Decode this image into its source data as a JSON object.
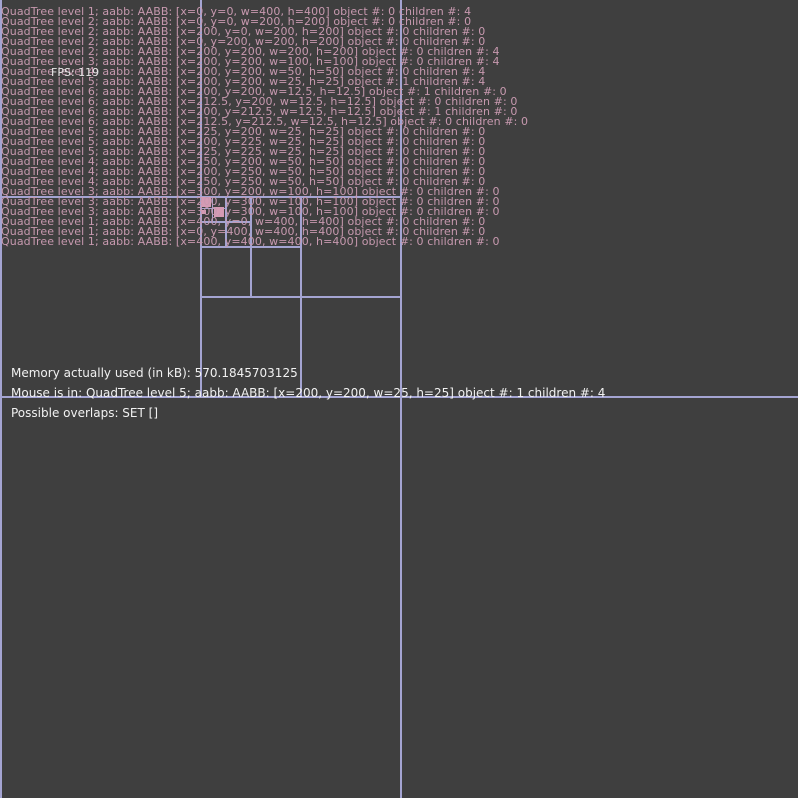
{
  "colors": {
    "background": "#3f3f3f",
    "grid_line": "#a4a4d2",
    "object": "#d59ab4",
    "debug_text": "#c799af",
    "info_text": "#f1f1f1"
  },
  "fps_label": "FPS: 119",
  "debug_lines": [
    "QuadTree level 1; aabb: AABB: [x=0, y=0, w=400, h=400] object #: 0 children #: 4",
    "QuadTree level 2; aabb: AABB: [x=0, y=0, w=200, h=200] object #: 0 children #: 0",
    "QuadTree level 2; aabb: AABB: [x=200, y=0, w=200, h=200] object #: 0 children #: 0",
    "QuadTree level 2; aabb: AABB: [x=0, y=200, w=200, h=200] object #: 0 children #: 0",
    "QuadTree level 2; aabb: AABB: [x=200, y=200, w=200, h=200] object #: 0 children #: 4",
    "QuadTree level 3; aabb: AABB: [x=200, y=200, w=100, h=100] object #: 0 children #: 4",
    "QuadTree level 4; aabb: AABB: [x=200, y=200, w=50, h=50] object #: 0 children #: 4",
    "QuadTree level 5; aabb: AABB: [x=200, y=200, w=25, h=25] object #: 1 children #: 4",
    "QuadTree level 6; aabb: AABB: [x=200, y=200, w=12.5, h=12.5] object #: 1 children #: 0",
    "QuadTree level 6; aabb: AABB: [x=212.5, y=200, w=12.5, h=12.5] object #: 0 children #: 0",
    "QuadTree level 6; aabb: AABB: [x=200, y=212.5, w=12.5, h=12.5] object #: 1 children #: 0",
    "QuadTree level 6; aabb: AABB: [x=212.5, y=212.5, w=12.5, h=12.5] object #: 0 children #: 0",
    "QuadTree level 5; aabb: AABB: [x=225, y=200, w=25, h=25] object #: 0 children #: 0",
    "QuadTree level 5; aabb: AABB: [x=200, y=225, w=25, h=25] object #: 0 children #: 0",
    "QuadTree level 5; aabb: AABB: [x=225, y=225, w=25, h=25] object #: 0 children #: 0",
    "QuadTree level 4; aabb: AABB: [x=250, y=200, w=50, h=50] object #: 0 children #: 0",
    "QuadTree level 4; aabb: AABB: [x=200, y=250, w=50, h=50] object #: 0 children #: 0",
    "QuadTree level 4; aabb: AABB: [x=250, y=250, w=50, h=50] object #: 0 children #: 0",
    "QuadTree level 3; aabb: AABB: [x=300, y=200, w=100, h=100] object #: 0 children #: 0",
    "QuadTree level 3; aabb: AABB: [x=200, y=300, w=100, h=100] object #: 0 children #: 0",
    "QuadTree level 3; aabb: AABB: [x=300, y=300, w=100, h=100] object #: 0 children #: 0",
    "QuadTree level 1; aabb: AABB: [x=400, y=0, w=400, h=400] object #: 0 children #: 0",
    "QuadTree level 1; aabb: AABB: [x=0, y=400, w=400, h=400] object #: 0 children #: 0",
    "QuadTree level 1; aabb: AABB: [x=400, y=400, w=400, h=400] object #: 0 children #: 0"
  ],
  "info": {
    "memory": "Memory actually used (in kB): 570.1845703125",
    "mouse": "Mouse is in: QuadTree level 5; aabb: AABB: [x=200, y=200, w=25, h=25] object #: 1 children #: 4",
    "overlaps": "Possible overlaps: SET []"
  }
}
